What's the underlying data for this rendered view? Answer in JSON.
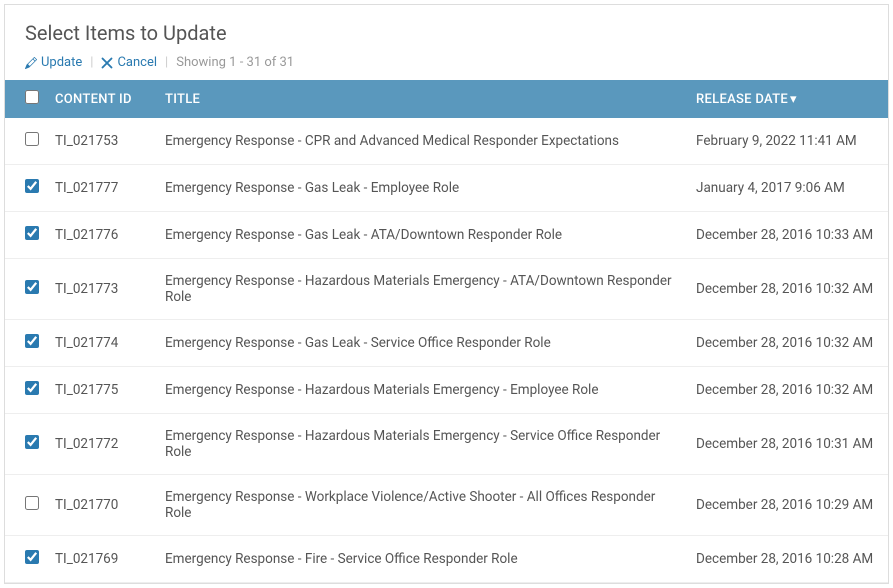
{
  "header": {
    "title": "Select Items to Update",
    "update_label": "Update",
    "cancel_label": "Cancel",
    "showing_text": "Showing 1 - 31 of 31"
  },
  "table": {
    "columns": {
      "content_id": "CONTENT ID",
      "title": "TITLE",
      "release_date": "RELEASE DATE"
    },
    "sort_indicator": "▾",
    "rows": [
      {
        "checked": false,
        "content_id": "TI_021753",
        "title": "Emergency Response - CPR and Advanced Medical Responder Expectations",
        "release_date": "February 9, 2022 11:41 AM"
      },
      {
        "checked": true,
        "content_id": "TI_021777",
        "title": "Emergency Response - Gas Leak - Employee Role",
        "release_date": "January 4, 2017 9:06 AM"
      },
      {
        "checked": true,
        "content_id": "TI_021776",
        "title": "Emergency Response - Gas Leak - ATA/Downtown Responder Role",
        "release_date": "December 28, 2016 10:33 AM"
      },
      {
        "checked": true,
        "content_id": "TI_021773",
        "title": "Emergency Response - Hazardous Materials Emergency - ATA/Downtown Responder Role",
        "release_date": "December 28, 2016 10:32 AM"
      },
      {
        "checked": true,
        "content_id": "TI_021774",
        "title": "Emergency Response - Gas Leak - Service Office Responder Role",
        "release_date": "December 28, 2016 10:32 AM"
      },
      {
        "checked": true,
        "content_id": "TI_021775",
        "title": "Emergency Response - Hazardous Materials Emergency - Employee Role",
        "release_date": "December 28, 2016 10:32 AM"
      },
      {
        "checked": true,
        "content_id": "TI_021772",
        "title": "Emergency Response - Hazardous Materials Emergency - Service Office Responder Role",
        "release_date": "December 28, 2016 10:31 AM"
      },
      {
        "checked": false,
        "content_id": "TI_021770",
        "title": "Emergency Response - Workplace Violence/Active Shooter - All Offices Responder Role",
        "release_date": "December 28, 2016 10:29 AM"
      },
      {
        "checked": true,
        "content_id": "TI_021769",
        "title": "Emergency Response - Fire - Service Office Responder Role",
        "release_date": "December 28, 2016 10:28 AM"
      }
    ],
    "select_all_checked": false
  }
}
